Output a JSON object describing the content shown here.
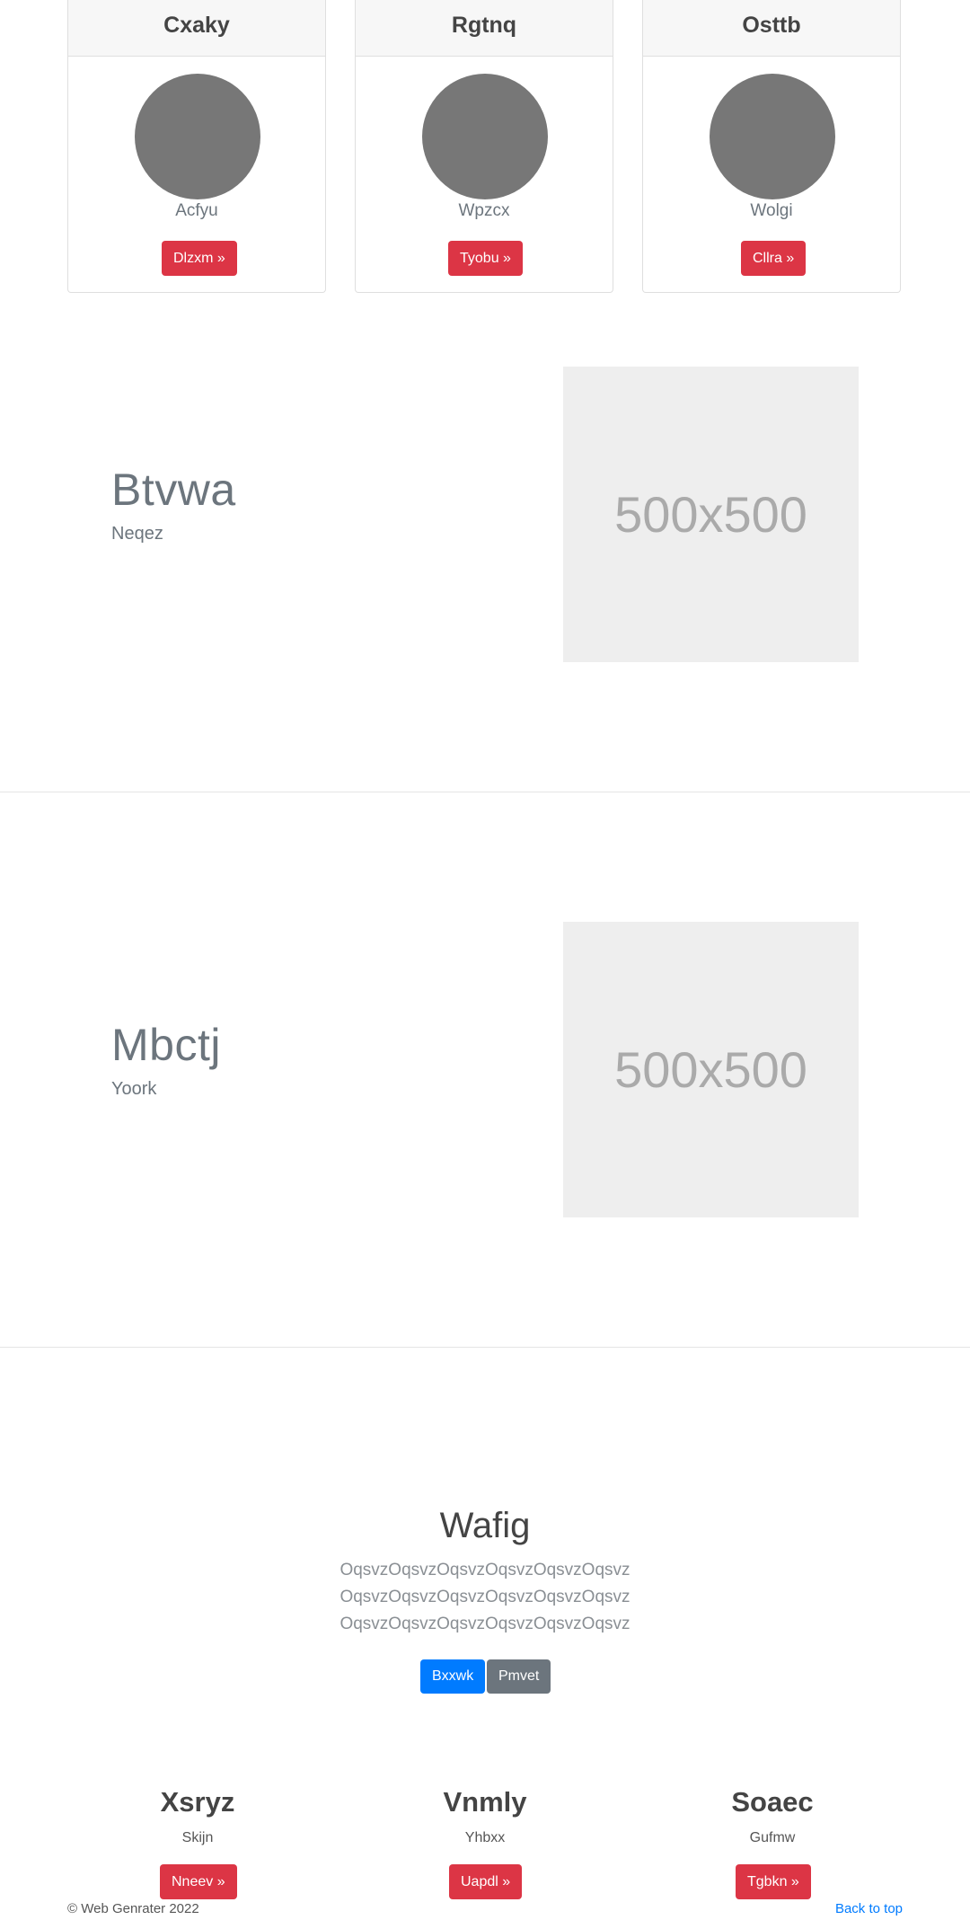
{
  "cards": [
    {
      "title": "Cxaky",
      "subtitle": "Acfyu",
      "button": "Dlzxm »"
    },
    {
      "title": "Rgtnq",
      "subtitle": "Wpzcx",
      "button": "Tyobu »"
    },
    {
      "title": "Osttb",
      "subtitle": "Wolgi",
      "button": "Cllra »"
    }
  ],
  "features": [
    {
      "heading": "Btvwa",
      "subheading": "Neqez",
      "image_label": "500x500"
    },
    {
      "heading": "Mbctj",
      "subheading": "Yoork",
      "image_label": "500x500"
    }
  ],
  "hero": {
    "title": "Wafig",
    "lines": [
      "OqsvzOqsvzOqsvzOqsvzOqsvzOqsvz",
      "OqsvzOqsvzOqsvzOqsvzOqsvzOqsvz",
      "OqsvzOqsvzOqsvzOqsvzOqsvzOqsvz"
    ],
    "primary_button": "Bxxwk",
    "secondary_button": "Pmvet"
  },
  "columns": [
    {
      "title": "Xsryz",
      "subtitle": "Skijn",
      "button": "Nneev »"
    },
    {
      "title": "Vnmly",
      "subtitle": "Yhbxx",
      "button": "Uapdl »"
    },
    {
      "title": "Soaec",
      "subtitle": "Gufmw",
      "button": "Tgbkn »"
    }
  ],
  "footer": {
    "copyright": "© Web Genrater 2022",
    "back_to_top": "Back to top"
  },
  "colors": {
    "danger": "#dc3545",
    "primary": "#007bff",
    "secondary": "#6c757d",
    "placeholder_bg": "#eeeeee",
    "avatar": "#777777"
  }
}
